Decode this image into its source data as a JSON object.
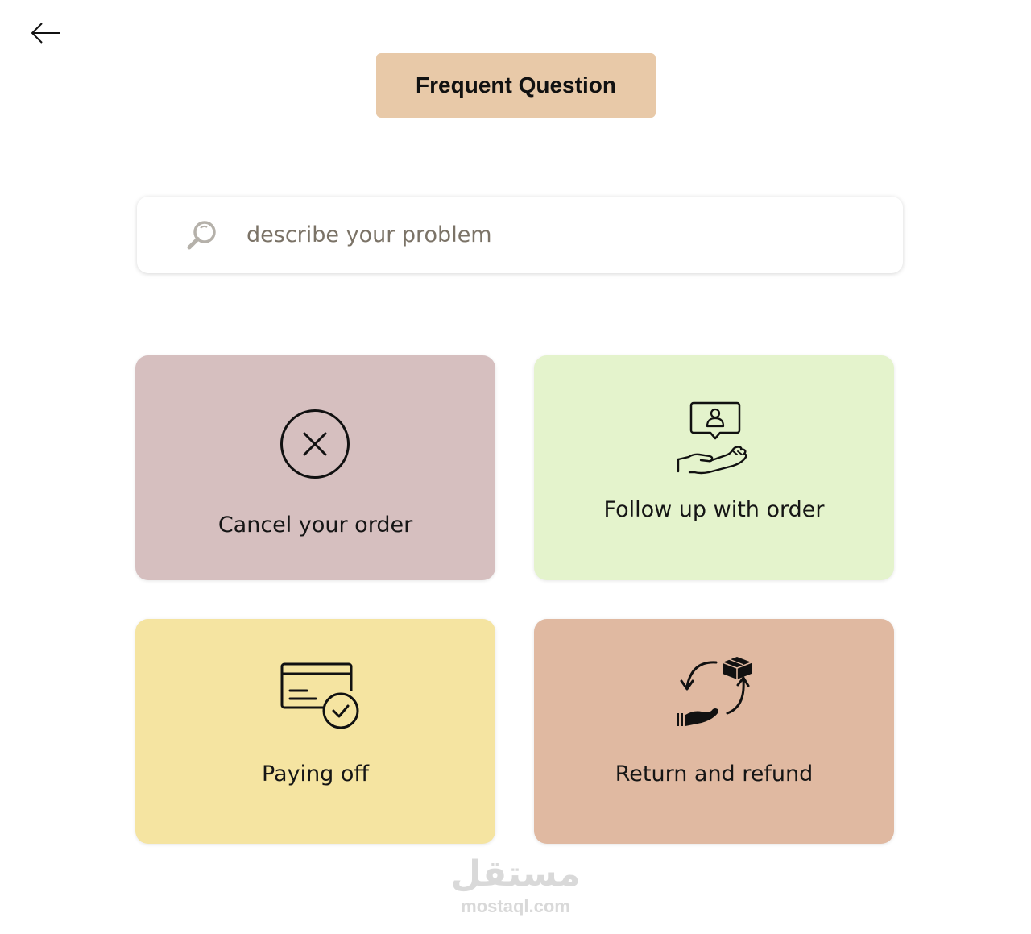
{
  "header": {
    "back_icon": "arrow-left-icon",
    "title": "Frequent Question",
    "title_bg": "#e8c9a8"
  },
  "search": {
    "icon": "search-icon",
    "placeholder": "describe your problem"
  },
  "cards": [
    {
      "label": "Cancel your order",
      "icon": "x-circle-icon",
      "bg": "#d6bfbf"
    },
    {
      "label": "Follow up with order",
      "icon": "hand-support-icon",
      "bg": "#e4f3cc"
    },
    {
      "label": "Paying off",
      "icon": "card-check-icon",
      "bg": "#f5e4a1"
    },
    {
      "label": "Return and refund",
      "icon": "return-box-icon",
      "bg": "#e0b9a1"
    }
  ],
  "watermark": {
    "arabic": "مستقل",
    "latin": "mostaql.com"
  }
}
